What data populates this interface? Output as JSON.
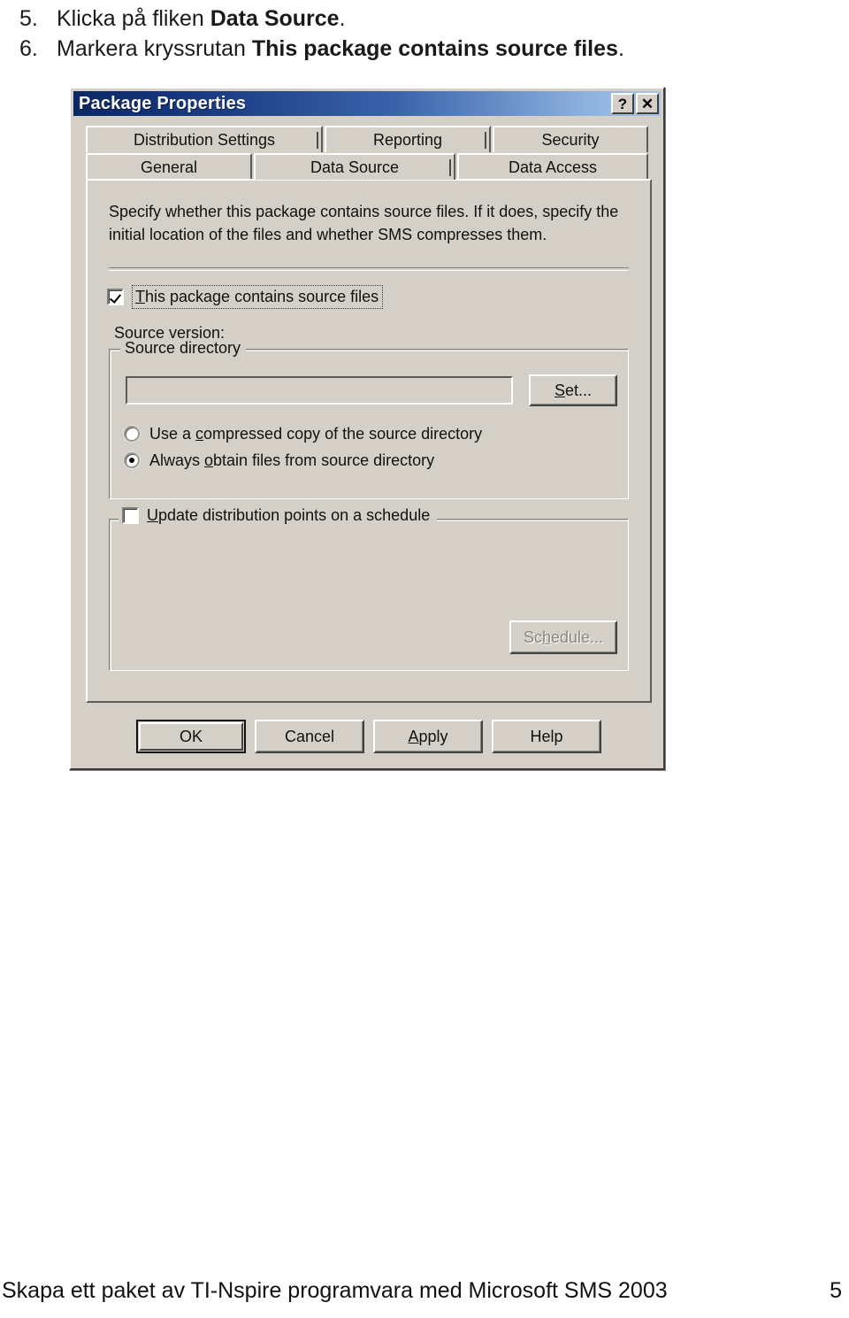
{
  "instructions": [
    {
      "num": "5.",
      "pre": "Klicka på fliken ",
      "bold": "Data Source",
      "post": "."
    },
    {
      "num": "6.",
      "pre": "Markera kryssrutan ",
      "bold": "This package contains source files",
      "post": "."
    }
  ],
  "dialog": {
    "title": "Package Properties",
    "titlebar_buttons": {
      "help": "?",
      "close": "✕"
    },
    "tabs_row1": [
      {
        "label": "Distribution Settings",
        "active": false
      },
      {
        "label": "Reporting",
        "active": false
      },
      {
        "label": "Security",
        "active": false
      }
    ],
    "tabs_row2": [
      {
        "label": "General",
        "active": false
      },
      {
        "label": "Data Source",
        "active": true
      },
      {
        "label": "Data Access",
        "active": false
      }
    ],
    "page": {
      "description_line1": "Specify whether this package contains source files.  If it does, specify the",
      "description_line2": "initial location of the files and whether SMS compresses them.",
      "source_files_checkbox": {
        "label_underlined": "T",
        "label_rest": "his package contains source files",
        "checked": true
      },
      "source_version_label": "Source version:",
      "source_directory_group": {
        "title": "Source directory",
        "path_value": "",
        "path_placeholder": "",
        "set_button": {
          "label_underlined": "S",
          "label_rest": "et..."
        },
        "radios": [
          {
            "pre": "Use a ",
            "underlined": "c",
            "post": "ompressed copy of the source directory",
            "selected": false
          },
          {
            "pre": "Always ",
            "underlined": "o",
            "post": "btain files from source directory",
            "selected": true
          }
        ]
      },
      "update_group": {
        "checkbox": {
          "label_underlined": "U",
          "label_rest": "pdate distribution points on a schedule",
          "checked": false
        },
        "schedule_button": {
          "pre": "Sc",
          "underlined": "h",
          "post": "edule...",
          "disabled": true
        }
      }
    },
    "buttons": [
      {
        "label": "OK",
        "default": true
      },
      {
        "label": "Cancel",
        "default": false
      },
      {
        "pre": "",
        "underlined": "A",
        "post": "pply",
        "default": false
      },
      {
        "label": "Help",
        "default": false
      }
    ]
  },
  "footer": {
    "text": "Skapa ett paket av TI-Nspire programvara med Microsoft SMS 2003",
    "page_number": "5"
  },
  "colors": {
    "dialog_face": "#d4d0c8",
    "titlebar_start": "#0b2864",
    "titlebar_end": "#a8c6ea",
    "text": "#111111",
    "disabled_text": "#8a8880"
  }
}
